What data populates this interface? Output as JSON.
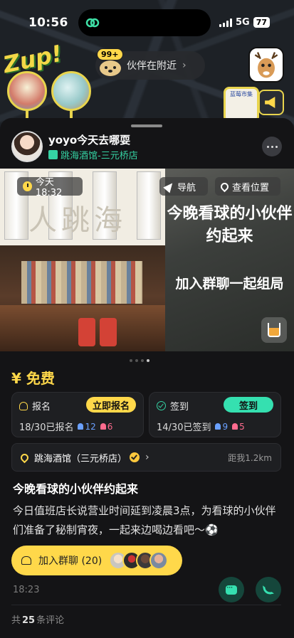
{
  "status_bar": {
    "time": "10:56",
    "network": "5G",
    "battery": "77"
  },
  "map": {
    "brand_sticker": "Zup!",
    "nearby": {
      "count": "99+",
      "label": "伙伴在附近"
    },
    "map_card_text": "蓝莓市集"
  },
  "host": {
    "name": "yoyo今天去哪耍",
    "venue": "跳海酒馆-三元桥店"
  },
  "banner": {
    "time_label": "今天18:32",
    "nav_label": "导航",
    "location_label": "查看位置",
    "headline": "今晚看球的小伙伴约起来",
    "subline": "加入群聊一起组局",
    "photo_sign": "人跳海"
  },
  "price": "¥ 免费",
  "signup": {
    "title": "报名",
    "action": "立即报名",
    "stat": "18/30已报名",
    "male": "12",
    "female": "6"
  },
  "checkin": {
    "title": "签到",
    "action": "签到",
    "stat": "14/30已签到",
    "male": "9",
    "female": "5"
  },
  "venue_row": {
    "name": "跳海酒馆（三元桥店）",
    "distance": "距我1.2km"
  },
  "event": {
    "title": "今晚看球的小伙伴约起来",
    "description": "今日值班店长说营业时间延到凌晨3点，为看球的小伙伴们准备了秘制宵夜，一起来边喝边看吧～⚽"
  },
  "join": {
    "label": "加入群聊 (20)"
  },
  "post_time": "18:23",
  "comments": {
    "prefix": "共",
    "count": "25",
    "suffix": "条评论"
  },
  "colors": {
    "accent_yellow": "#ffd84a",
    "accent_green": "#35e0b0",
    "background": "#141416"
  }
}
